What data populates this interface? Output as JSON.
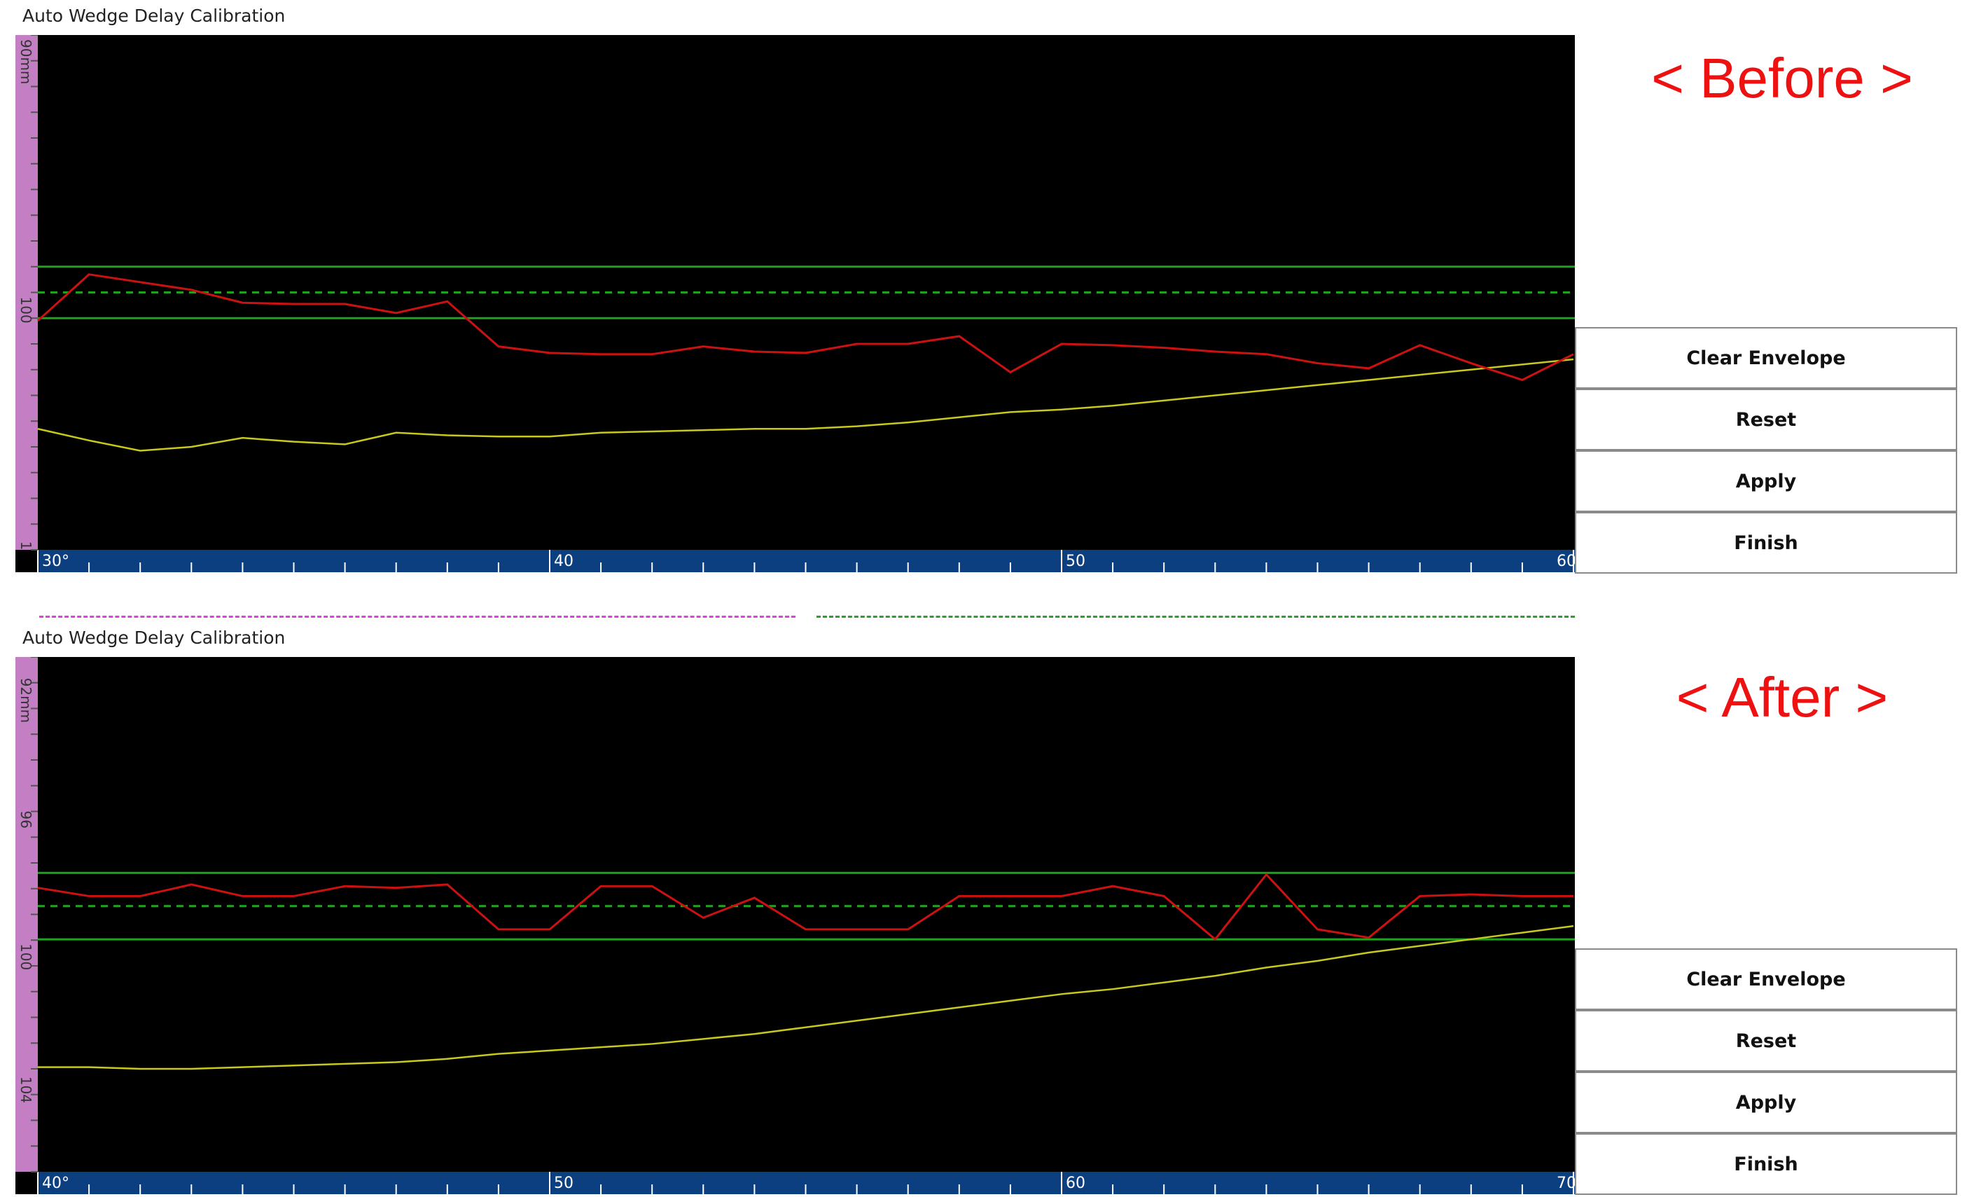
{
  "panels": [
    {
      "title": "Auto Wedge Delay Calibration",
      "label": "< Before >",
      "y_axis": {
        "range": [
          90,
          110
        ],
        "labels": [
          {
            "text": "90mm",
            "value": 90
          },
          {
            "text": "100",
            "value": 100
          },
          {
            "text": "1",
            "value": 109.5
          }
        ],
        "unit": "mm"
      },
      "x_axis": {
        "range": [
          30,
          60
        ],
        "labels": [
          {
            "text": "30°",
            "value": 30
          },
          {
            "text": "40",
            "value": 40
          },
          {
            "text": "50",
            "value": 50
          },
          {
            "text": "60",
            "value": 60
          }
        ]
      },
      "gate": {
        "upper": 99.0,
        "center": 100.0,
        "lower": 101.0
      },
      "envelope_points": [
        [
          30,
          101.1
        ],
        [
          31,
          99.3
        ],
        [
          32,
          99.6
        ],
        [
          33,
          99.9
        ],
        [
          34,
          100.4
        ],
        [
          35,
          100.45
        ],
        [
          36,
          100.45
        ],
        [
          37,
          100.8
        ],
        [
          38,
          100.35
        ],
        [
          39,
          102.1
        ],
        [
          40,
          102.35
        ],
        [
          41,
          102.4
        ],
        [
          42,
          102.4
        ],
        [
          43,
          102.1
        ],
        [
          44,
          102.3
        ],
        [
          45,
          102.35
        ],
        [
          46,
          102.0
        ],
        [
          47,
          102.0
        ],
        [
          48,
          101.7
        ],
        [
          49,
          103.1
        ],
        [
          50,
          102.0
        ],
        [
          51,
          102.05
        ],
        [
          52,
          102.15
        ],
        [
          53,
          102.3
        ],
        [
          54,
          102.4
        ],
        [
          55,
          102.75
        ],
        [
          56,
          102.95
        ],
        [
          57,
          102.05
        ],
        [
          58,
          102.75
        ],
        [
          59,
          103.4
        ],
        [
          60,
          102.4
        ]
      ],
      "current_points": [
        [
          30,
          105.3
        ],
        [
          31,
          105.75
        ],
        [
          32,
          106.15
        ],
        [
          33,
          106.0
        ],
        [
          34,
          105.65
        ],
        [
          35,
          105.8
        ],
        [
          36,
          105.9
        ],
        [
          37,
          105.45
        ],
        [
          38,
          105.55
        ],
        [
          39,
          105.6
        ],
        [
          40,
          105.6
        ],
        [
          41,
          105.45
        ],
        [
          42,
          105.4
        ],
        [
          43,
          105.35
        ],
        [
          44,
          105.3
        ],
        [
          45,
          105.3
        ],
        [
          46,
          105.2
        ],
        [
          47,
          105.05
        ],
        [
          48,
          104.85
        ],
        [
          49,
          104.65
        ],
        [
          50,
          104.55
        ],
        [
          51,
          104.4
        ],
        [
          52,
          104.2
        ],
        [
          53,
          104.0
        ],
        [
          54,
          103.8
        ],
        [
          55,
          103.6
        ],
        [
          56,
          103.4
        ],
        [
          57,
          103.2
        ],
        [
          58,
          103.0
        ],
        [
          59,
          102.8
        ],
        [
          60,
          102.6
        ]
      ],
      "buttons": [
        "Clear Envelope",
        "Reset",
        "Apply",
        "Finish"
      ]
    },
    {
      "title": "Auto Wedge Delay Calibration",
      "label": "< After >",
      "y_axis": {
        "range": [
          91.5,
          107
        ],
        "labels": [
          {
            "text": "92mm",
            "value": 92
          },
          {
            "text": "96",
            "value": 96
          },
          {
            "text": "100",
            "value": 100
          },
          {
            "text": "104",
            "value": 104
          }
        ],
        "unit": "mm"
      },
      "x_axis": {
        "range": [
          40,
          70
        ],
        "labels": [
          {
            "text": "40°",
            "value": 40
          },
          {
            "text": "50",
            "value": 50
          },
          {
            "text": "60",
            "value": 60
          },
          {
            "text": "70",
            "value": 70
          }
        ]
      },
      "gate": {
        "upper": 98.0,
        "center": 99.0,
        "lower": 100.0
      },
      "envelope_points": [
        [
          40,
          98.45
        ],
        [
          41,
          98.7
        ],
        [
          42,
          98.7
        ],
        [
          43,
          98.35
        ],
        [
          44,
          98.7
        ],
        [
          45,
          98.7
        ],
        [
          46,
          98.4
        ],
        [
          47,
          98.45
        ],
        [
          48,
          98.35
        ],
        [
          49,
          99.7
        ],
        [
          50,
          99.7
        ],
        [
          51,
          98.4
        ],
        [
          52,
          98.4
        ],
        [
          53,
          99.35
        ],
        [
          54,
          98.75
        ],
        [
          55,
          99.7
        ],
        [
          56,
          99.7
        ],
        [
          57,
          99.7
        ],
        [
          58,
          98.7
        ],
        [
          59,
          98.7
        ],
        [
          60,
          98.7
        ],
        [
          61,
          98.4
        ],
        [
          62,
          98.7
        ],
        [
          63,
          100.0
        ],
        [
          64,
          98.05
        ],
        [
          65,
          99.7
        ],
        [
          66,
          99.95
        ],
        [
          67,
          98.7
        ],
        [
          68,
          98.65
        ],
        [
          69,
          98.7
        ],
        [
          70,
          98.7
        ]
      ],
      "current_points": [
        [
          40,
          103.85
        ],
        [
          41,
          103.85
        ],
        [
          42,
          103.9
        ],
        [
          43,
          103.9
        ],
        [
          44,
          103.85
        ],
        [
          45,
          103.8
        ],
        [
          46,
          103.75
        ],
        [
          47,
          103.7
        ],
        [
          48,
          103.6
        ],
        [
          49,
          103.45
        ],
        [
          50,
          103.35
        ],
        [
          51,
          103.25
        ],
        [
          52,
          103.15
        ],
        [
          53,
          103.0
        ],
        [
          54,
          102.85
        ],
        [
          55,
          102.65
        ],
        [
          56,
          102.45
        ],
        [
          57,
          102.25
        ],
        [
          58,
          102.05
        ],
        [
          59,
          101.85
        ],
        [
          60,
          101.65
        ],
        [
          61,
          101.5
        ],
        [
          62,
          101.3
        ],
        [
          63,
          101.1
        ],
        [
          64,
          100.85
        ],
        [
          65,
          100.65
        ],
        [
          66,
          100.4
        ],
        [
          67,
          100.2
        ],
        [
          68,
          100.0
        ],
        [
          69,
          99.8
        ],
        [
          70,
          99.6
        ]
      ],
      "buttons": [
        "Clear Envelope",
        "Reset",
        "Apply",
        "Finish"
      ]
    }
  ],
  "colors": {
    "plot_bg": "#000000",
    "y_axis_bar": "#c47fc4",
    "x_axis_bar": "#0b3f80",
    "gate": "#1fa31f",
    "envelope": "#cc1111",
    "current": "#c8c81e",
    "separator_left": "#e040e0",
    "separator_right": "#2e9e2e",
    "label": "#ee1111"
  }
}
